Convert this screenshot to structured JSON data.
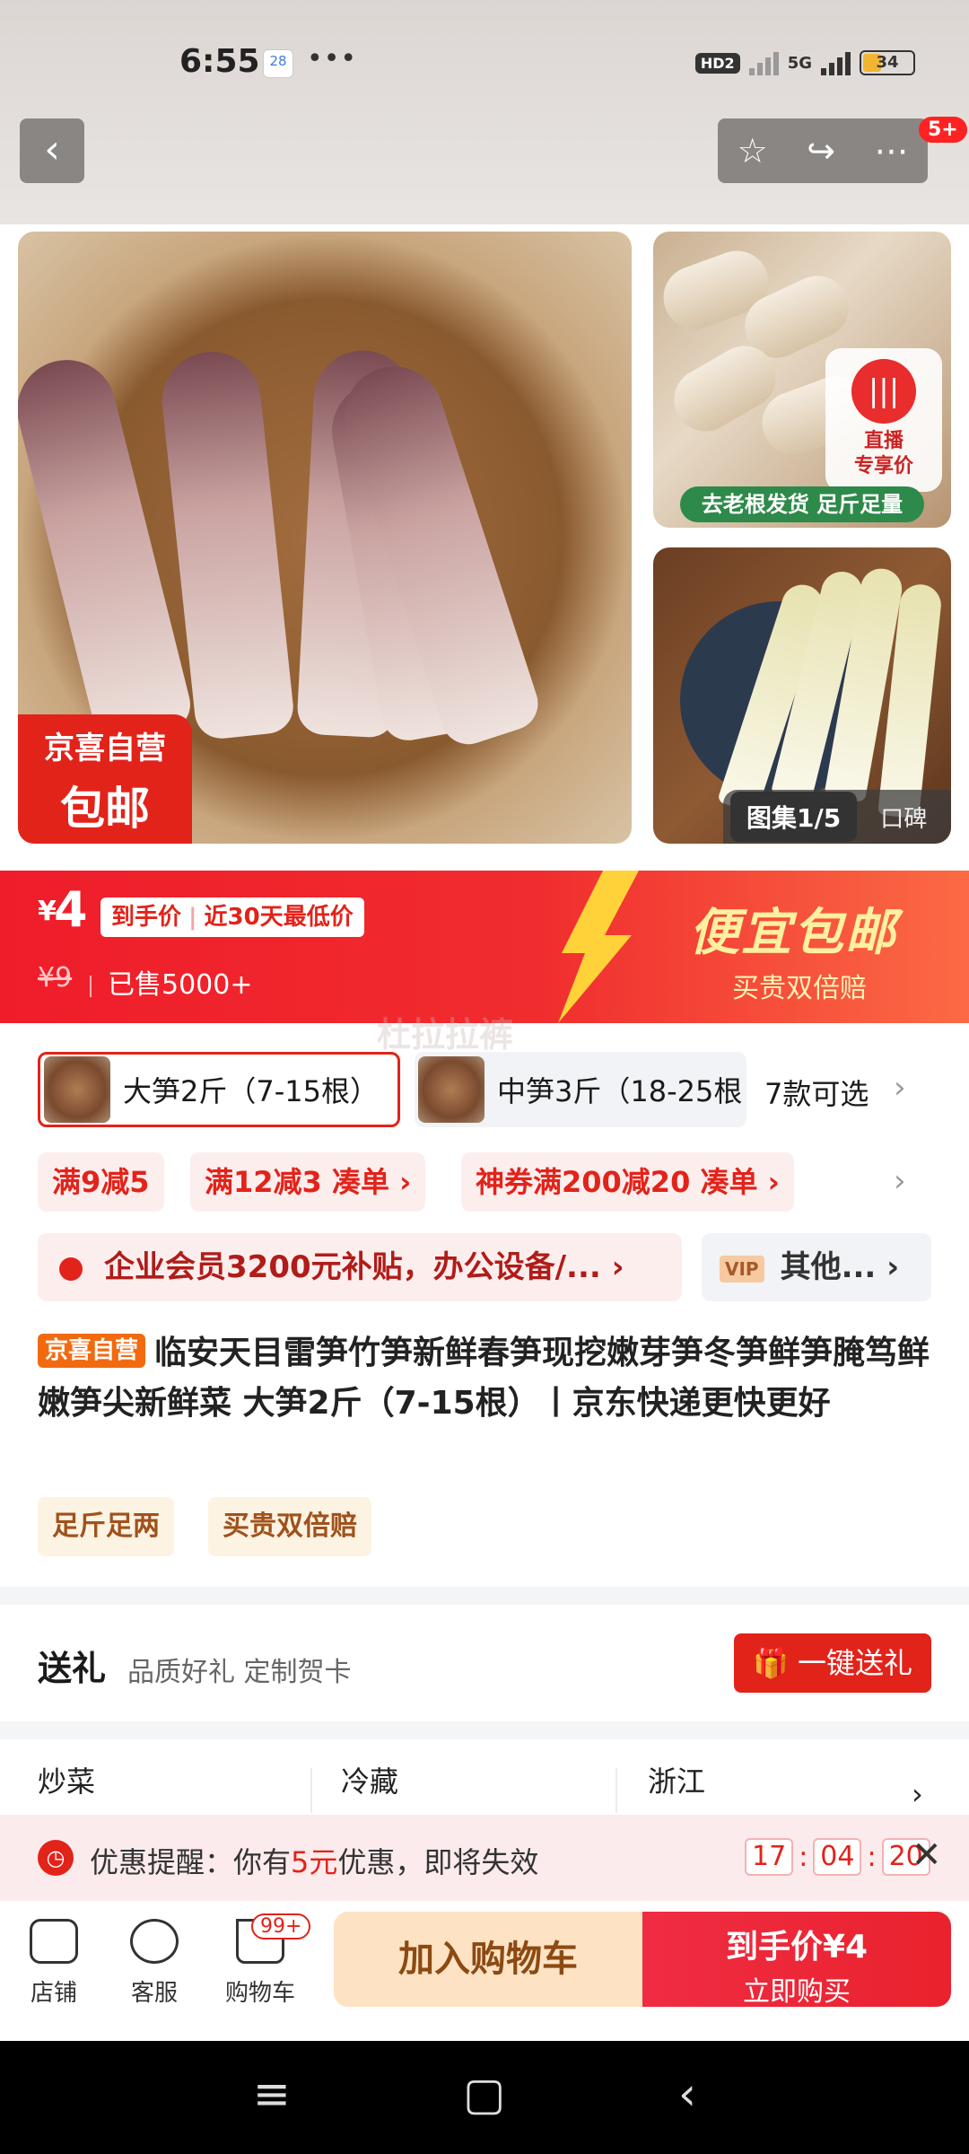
{
  "status": {
    "time": "6:55",
    "calendar": "28",
    "more": "•••",
    "hd": "HD2",
    "network": "5G",
    "battery": "34"
  },
  "nav": {
    "back_icon": "‹",
    "badge": "5+"
  },
  "gallery": {
    "main_tag_line1": "京喜自营",
    "main_tag_line2": "包邮",
    "side1_caption": "去老根发货  足斤足量",
    "live_line1": "直播",
    "live_line2": "专享价",
    "album": "图集1/5",
    "reviews": "口碑"
  },
  "price": {
    "yen": "¥",
    "value": "4",
    "label": "到手价",
    "label2": "近30天最低价",
    "old": "¥9",
    "sold": "已售5000+",
    "promo_title": "便宜包邮",
    "promo_sub": "买贵双倍赔"
  },
  "watermark": "杜拉拉裤",
  "variants": {
    "v1": "大笋2斤（7-15根）",
    "v2": "中笋3斤（18-25根",
    "more": "7款可选"
  },
  "coupons": [
    "满9减5",
    "满12减3  凑单 ›",
    "神券满200减20  凑单 ›"
  ],
  "member": {
    "text": "企业会员3200元补贴，办公设备/...  ›",
    "other_vip": "VIP",
    "other": "其他... ›"
  },
  "product": {
    "badge": "京喜自营",
    "title": "临安天目雷笋竹笋新鲜春笋现挖嫩芽笋冬笋鲜笋腌笃鲜嫩笋尖新鲜菜 大笋2斤（7-15根）丨京东快递更快更好",
    "features": [
      "足斤足两",
      "买贵双倍赔"
    ]
  },
  "gift": {
    "title": "送礼",
    "sub": "品质好礼  定制贺卡",
    "button": "一键送礼"
  },
  "tags": [
    "炒菜",
    "冷藏",
    "浙江"
  ],
  "reminder": {
    "prefix": "优惠提醒：你有",
    "amount": "5元",
    "suffix": "优惠，即将失效",
    "h": "17",
    "m": "04",
    "s": "20"
  },
  "bottom": {
    "shop": "店铺",
    "service": "客服",
    "cart": "购物车",
    "cart_badge": "99+",
    "add_cart": "加入购物车",
    "buy_price": "到手价¥4",
    "buy_now": "立即购买"
  },
  "colors": {
    "brand_red": "#e2231a",
    "promo_yellow": "#fff0a0"
  }
}
